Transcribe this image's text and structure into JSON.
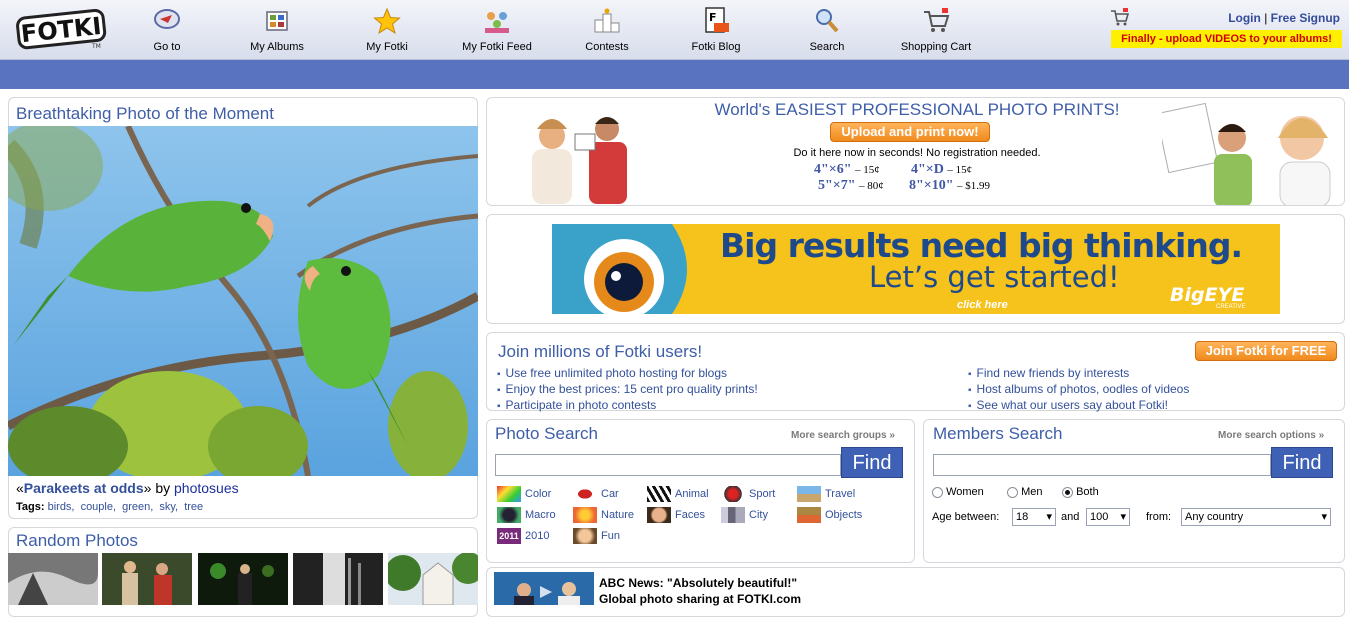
{
  "header": {
    "logo_text": "Fotki",
    "nav": [
      {
        "label": "Go to",
        "icon": "goto-icon"
      },
      {
        "label": "My Albums",
        "icon": "albums-icon"
      },
      {
        "label": "My Fotki",
        "icon": "star-icon"
      },
      {
        "label": "My Fotki Feed",
        "icon": "feed-icon"
      },
      {
        "label": "Contests",
        "icon": "podium-icon"
      },
      {
        "label": "Fotki Blog",
        "icon": "blog-icon"
      },
      {
        "label": "Search",
        "icon": "magnifier-icon"
      },
      {
        "label": "Shopping Cart",
        "icon": "cart-icon"
      }
    ],
    "login": "Login",
    "separator": "|",
    "signup": "Free Signup",
    "promo": "Finally - upload VIDEOS to your albums!"
  },
  "photo_of_moment": {
    "title": "Breathtaking Photo of the Moment",
    "quote_open": "«",
    "photo_title": "Parakeets at odds",
    "quote_close": "»",
    "by": "by",
    "author": "photosues",
    "tags_label": "Tags:",
    "tags": [
      "birds,",
      "couple,",
      "green,",
      "sky,",
      "tree"
    ]
  },
  "random_photos": {
    "title": "Random Photos"
  },
  "prints": {
    "headline": "World's EASIEST PROFESSIONAL PHOTO PRINTS!",
    "button": "Upload and print now!",
    "subline": "Do it here now in seconds! No registration needed.",
    "prices": [
      {
        "size": "4\"×6\"",
        "price": "– 15¢"
      },
      {
        "size": "4\"×D",
        "price": "– 15¢"
      },
      {
        "size": "5\"×7\"",
        "price": "– 80¢"
      },
      {
        "size": "8\"×10\"",
        "price": "– $1.99"
      }
    ]
  },
  "ad": {
    "line1": "Big results need big thinking.",
    "line2": "Let’s get started!",
    "click": "click here",
    "brand": "BigEYE",
    "brand_sub": "CREATIVE"
  },
  "join": {
    "title": "Join millions of Fotki users!",
    "button": "Join Fotki for FREE",
    "left": [
      "Use free unlimited photo hosting for blogs",
      "Enjoy the best prices: 15 cent pro quality prints!",
      "Participate in photo contests"
    ],
    "right": [
      "Find new friends by interests",
      "Host albums of photos, oodles of videos",
      "See what our users say about Fotki!"
    ]
  },
  "photo_search": {
    "title": "Photo Search",
    "more": "More search groups »",
    "find": "Find",
    "categories": [
      {
        "label": "Color",
        "icon": "color-icon"
      },
      {
        "label": "Car",
        "icon": "car-icon"
      },
      {
        "label": "Animal",
        "icon": "zebra-icon"
      },
      {
        "label": "Sport",
        "icon": "sport-icon"
      },
      {
        "label": "Travel",
        "icon": "travel-icon"
      },
      {
        "label": "Macro",
        "icon": "macro-icon"
      },
      {
        "label": "Nature",
        "icon": "nature-icon"
      },
      {
        "label": "Faces",
        "icon": "face-icon"
      },
      {
        "label": "City",
        "icon": "city-icon"
      },
      {
        "label": "Objects",
        "icon": "objects-icon"
      },
      {
        "label": "2010",
        "icon": "year-2010-icon",
        "badge": "2011"
      },
      {
        "label": "Fun",
        "icon": "fun-icon"
      }
    ]
  },
  "members_search": {
    "title": "Members Search",
    "more": "More search options »",
    "find": "Find",
    "gender": [
      "Women",
      "Men",
      "Both"
    ],
    "selected_gender": "Both",
    "age_label": "Age between:",
    "age_from": "18",
    "and": "and",
    "age_to": "100",
    "from_label": "from:",
    "country": "Any country"
  },
  "news": {
    "line1": "ABC News: \"Absolutely beautiful!\"",
    "line2": "Global photo sharing at FOTKI.com"
  },
  "colors": {
    "accent": "#3f5ea8",
    "band": "#5a73c0",
    "promo_bg": "#ffef00",
    "promo_text": "#d10000",
    "orange": "#f08a1c"
  }
}
